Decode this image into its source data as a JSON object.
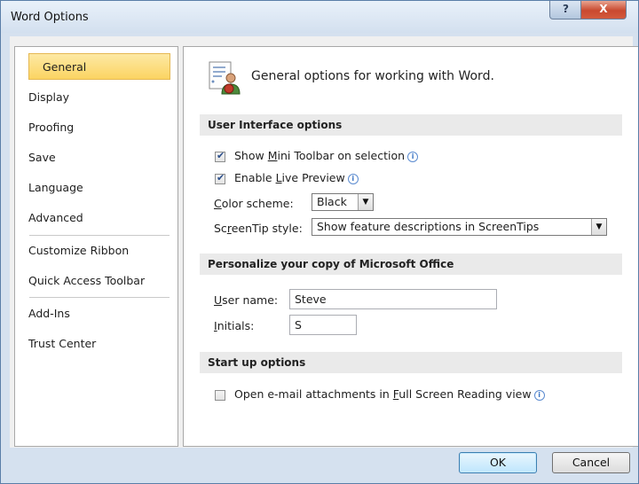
{
  "window": {
    "title": "Word Options",
    "help_label": "?",
    "close_label": "X"
  },
  "sidebar": {
    "items": [
      {
        "label": "General",
        "selected": true
      },
      {
        "label": "Display"
      },
      {
        "label": "Proofing"
      },
      {
        "label": "Save"
      },
      {
        "label": "Language"
      },
      {
        "label": "Advanced"
      },
      {
        "label": "Customize Ribbon"
      },
      {
        "label": "Quick Access Toolbar"
      },
      {
        "label": "Add-Ins"
      },
      {
        "label": "Trust Center"
      }
    ]
  },
  "main": {
    "header": {
      "text": "General options for working with Word.",
      "icon": "general-options-icon"
    },
    "ui_options": {
      "title": "User Interface options",
      "mini_toolbar": {
        "pre": "Show ",
        "accel": "M",
        "post": "ini Toolbar on selection",
        "checked": true
      },
      "live_preview": {
        "pre": "Enable ",
        "accel": "L",
        "post": "ive Preview",
        "checked": true
      },
      "color_scheme": {
        "accel": "C",
        "label_rest": "olor scheme:",
        "value": "Black"
      },
      "screentip": {
        "pre": "Sc",
        "accel": "r",
        "post": "eenTip style:",
        "value": "Show feature descriptions in ScreenTips"
      }
    },
    "personalize": {
      "title": "Personalize your copy of Microsoft Office",
      "user_name": {
        "accel": "U",
        "label_rest": "ser name:",
        "value": "Steve"
      },
      "initials": {
        "accel": "I",
        "label_rest": "nitials:",
        "value": "S"
      }
    },
    "startup": {
      "title": "Start up options",
      "open_email": {
        "pre": "Open e-mail attachments in ",
        "accel": "F",
        "post": "ull Screen Reading view",
        "checked": false
      }
    }
  },
  "footer": {
    "ok_label": "OK",
    "cancel_label": "Cancel"
  },
  "colors": {
    "selected_nav": "#fbd462",
    "section_bg": "#eaeaea",
    "close_red": "#c9492f",
    "frame": "#d5e1ef"
  }
}
